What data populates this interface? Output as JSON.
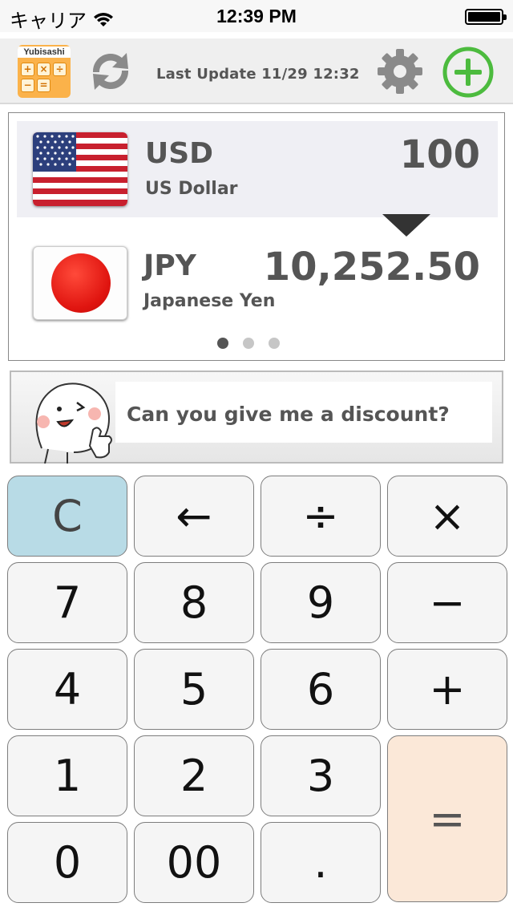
{
  "status_bar": {
    "carrier": "キャリア",
    "time": "12:39 PM"
  },
  "toolbar": {
    "app_logo_text": "Yubisashi",
    "logo_keys": [
      "+",
      "×",
      "÷",
      "−",
      "=",
      ""
    ],
    "last_update": "Last Update 11/29 12:32",
    "icons": [
      "sync-icon",
      "gear-icon",
      "plus-circle-icon"
    ],
    "accent_green": "#4cbb3e"
  },
  "converter": {
    "from": {
      "code": "USD",
      "name": "US Dollar",
      "amount": "100",
      "flag": "us-flag-icon"
    },
    "to": {
      "code": "JPY",
      "name": "Japanese Yen",
      "amount": "10,252.50",
      "flag": "jp-flag-icon"
    },
    "page_count": 3,
    "active_page": 0
  },
  "phrase": {
    "text": "Can you give me a discount?"
  },
  "keypad": {
    "clear": "C",
    "backspace": "←",
    "divide": "÷",
    "multiply": "×",
    "seven": "7",
    "eight": "8",
    "nine": "9",
    "minus": "−",
    "four": "4",
    "five": "5",
    "six": "6",
    "plus": "+",
    "one": "1",
    "two": "2",
    "three": "3",
    "equals": "=",
    "zero": "0",
    "double_zero": "00",
    "decimal": ".",
    "colors": {
      "clear_bg": "#b8dbe6",
      "equals_bg": "#fbe8d8",
      "key_bg": "#f5f5f5"
    }
  }
}
